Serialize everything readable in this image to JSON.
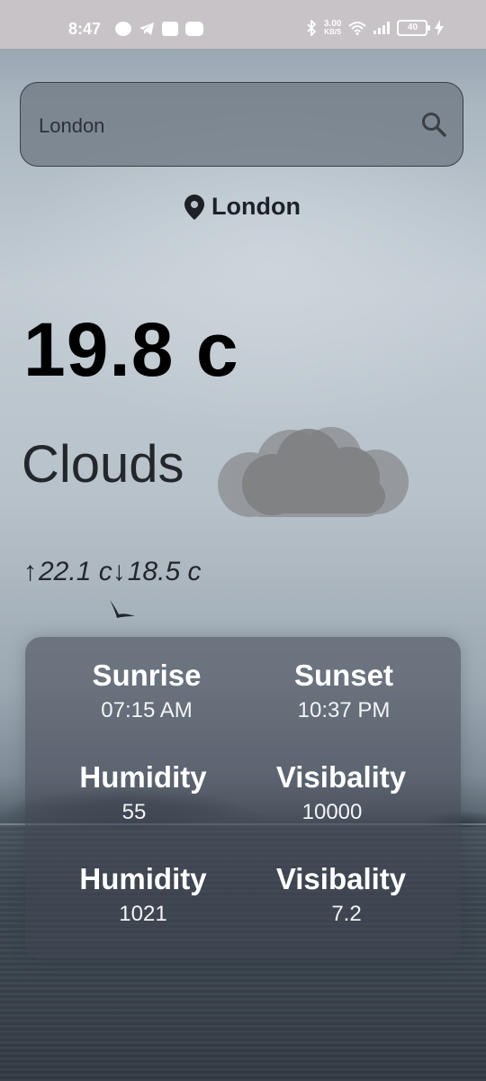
{
  "status_bar": {
    "time": "8:47",
    "speed_value": "3.00",
    "speed_unit": "KB/S",
    "battery": "40",
    "left_icons": [
      "whatsapp-icon",
      "telegram-icon",
      "linkedin-icon",
      "youtube-icon"
    ],
    "right_icons": [
      "bluetooth-icon",
      "wifi-icon",
      "signal-icon",
      "battery-icon",
      "charging-icon"
    ]
  },
  "search": {
    "value": "London",
    "icon": "search-icon"
  },
  "location": {
    "icon": "location-pin-icon",
    "name": "London"
  },
  "weather": {
    "temperature": "19.8 c",
    "condition": "Clouds",
    "condition_icon": "cloud-icon",
    "max_temp": "22.1 c",
    "min_temp": "18.5 c"
  },
  "details": {
    "sunrise_label": "Sunrise",
    "sunrise_value": "07:15 AM",
    "sunset_label": "Sunset",
    "sunset_value": "10:37 PM",
    "humidity_label": "Humidity",
    "humidity_value": "55",
    "visibility_label": "Visibality",
    "visibility_value": "10000",
    "humidity2_label": "Humidity",
    "humidity2_value": "1021",
    "visibility2_label": "Visibality",
    "visibility2_value": "7.2"
  },
  "colors": {
    "card_bg": "#404652",
    "text_dark": "#1d2126",
    "status_bar_bg": "#c7c3c6"
  }
}
